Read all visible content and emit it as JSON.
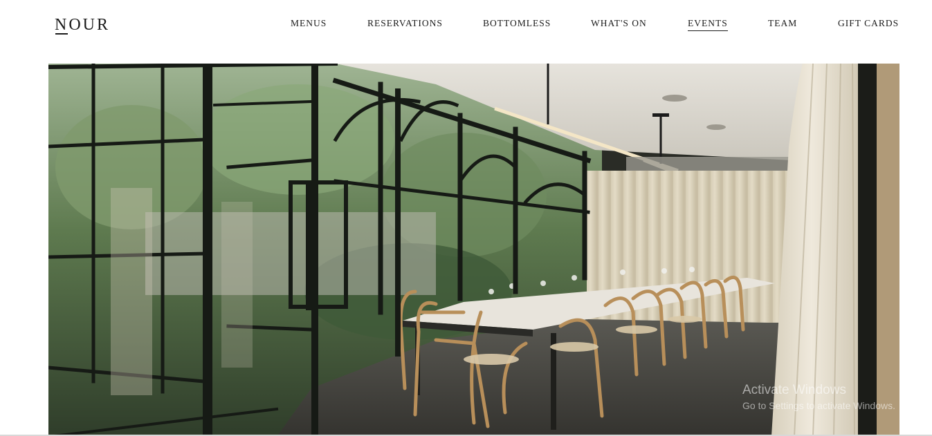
{
  "header": {
    "logo_text": "NOUR",
    "nav": [
      {
        "label": "MENUS",
        "active": false
      },
      {
        "label": "RESERVATIONS",
        "active": false
      },
      {
        "label": "BOTTOMLESS",
        "active": false
      },
      {
        "label": "WHAT'S ON",
        "active": false
      },
      {
        "label": "EVENTS",
        "active": true
      },
      {
        "label": "TEAM",
        "active": false
      },
      {
        "label": "GIFT CARDS",
        "active": false
      }
    ]
  },
  "hero": {
    "image_subject": "private-dining-room-photo"
  },
  "watermark": {
    "title": "Activate Windows",
    "subtitle": "Go to Settings to activate Windows."
  },
  "colors": {
    "text": "#1a1a1a",
    "background": "#ffffff",
    "frame": "#1c1f1b",
    "curtain": "#d9d0ba",
    "chair": "#b88f5a"
  }
}
